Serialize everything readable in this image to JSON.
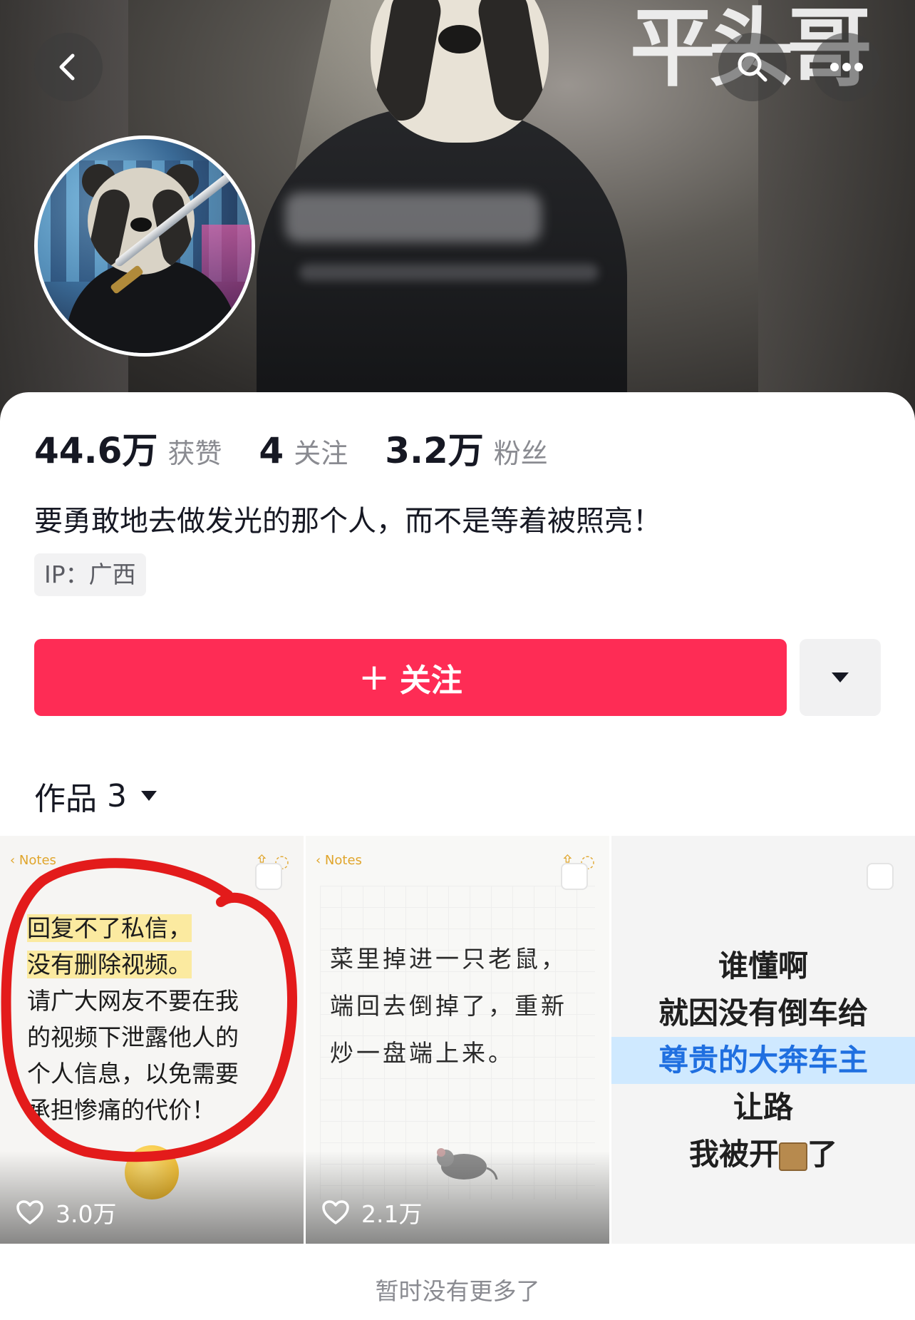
{
  "header": {
    "back_icon": "chevron-left-icon",
    "search_icon": "search-icon",
    "more_icon": "more-horizontal-icon",
    "banner_title": "平头哥"
  },
  "profile": {
    "stats": [
      {
        "value": "44.6万",
        "label": "获赞"
      },
      {
        "value": "4",
        "label": "关注"
      },
      {
        "value": "3.2万",
        "label": "粉丝"
      }
    ],
    "bio": "要勇敢地去做发光的那个人，而不是等着被照亮！",
    "ip": "IP：广西",
    "follow_label": "关注",
    "follow_plus": "+"
  },
  "works": {
    "label": "作品",
    "count": "3"
  },
  "videos": [
    {
      "notes_back": "Notes",
      "lines": [
        "回复不了私信，",
        "没有删除视频。",
        "请广大网友不要在我",
        "的视频下泄露他人的",
        "个人信息，以免需要",
        "承担惨痛的代价！"
      ],
      "likes": "3.0万"
    },
    {
      "notes_back": "Notes",
      "lines": [
        "菜里掉进一只老鼠，",
        "端回去倒掉了，重新",
        "炒一盘端上来。"
      ],
      "likes": "2.1万"
    },
    {
      "lines": [
        "谁懂啊",
        "就因没有倒车给",
        "尊贵的大奔车主",
        "让路",
        "我被开",
        "了"
      ]
    }
  ],
  "footer": "暂时没有更多了",
  "colors": {
    "accent": "#fe2c55",
    "annotation": "#e31b1b"
  }
}
